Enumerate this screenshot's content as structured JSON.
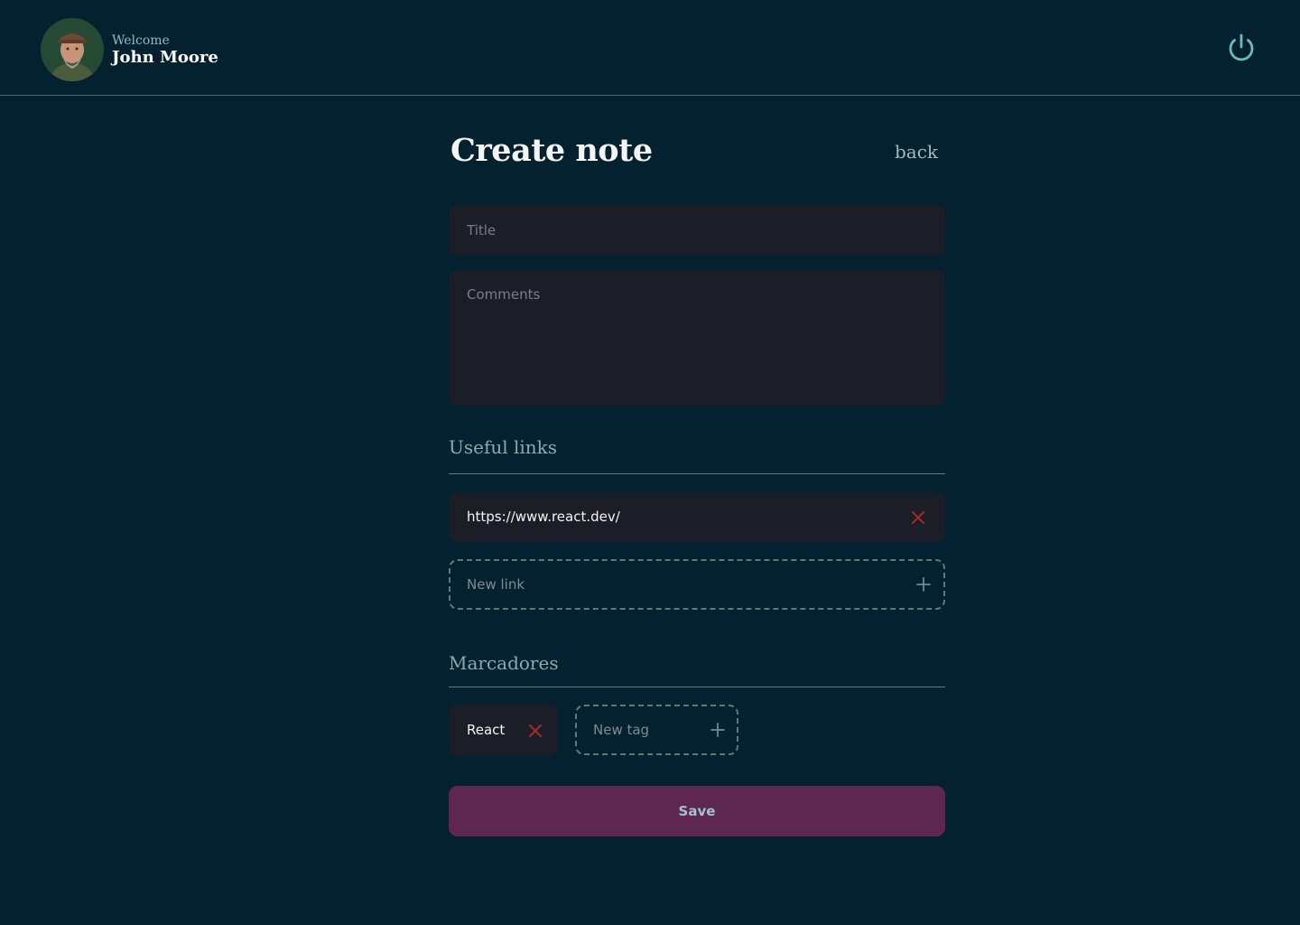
{
  "header": {
    "welcome": "Welcome",
    "user_name": "John Moore",
    "logout_icon": "power-icon"
  },
  "page": {
    "title": "Create note",
    "back_label": "back"
  },
  "form": {
    "title_placeholder": "Title",
    "comments_placeholder": "Comments"
  },
  "links": {
    "heading": "Useful links",
    "items": [
      {
        "url": "https://www.react.dev/"
      }
    ],
    "new_placeholder": "New link"
  },
  "tags": {
    "heading": "Marcadores",
    "items": [
      {
        "label": "React"
      }
    ],
    "new_placeholder": "New tag"
  },
  "actions": {
    "save_label": "Save"
  },
  "colors": {
    "background": "#04212F",
    "input_bg": "#1C1E27",
    "accent": "#5E2750",
    "remove": "#A52A2A",
    "muted_text": "#8FA9AE",
    "power_icon": "#6FB7C1"
  }
}
